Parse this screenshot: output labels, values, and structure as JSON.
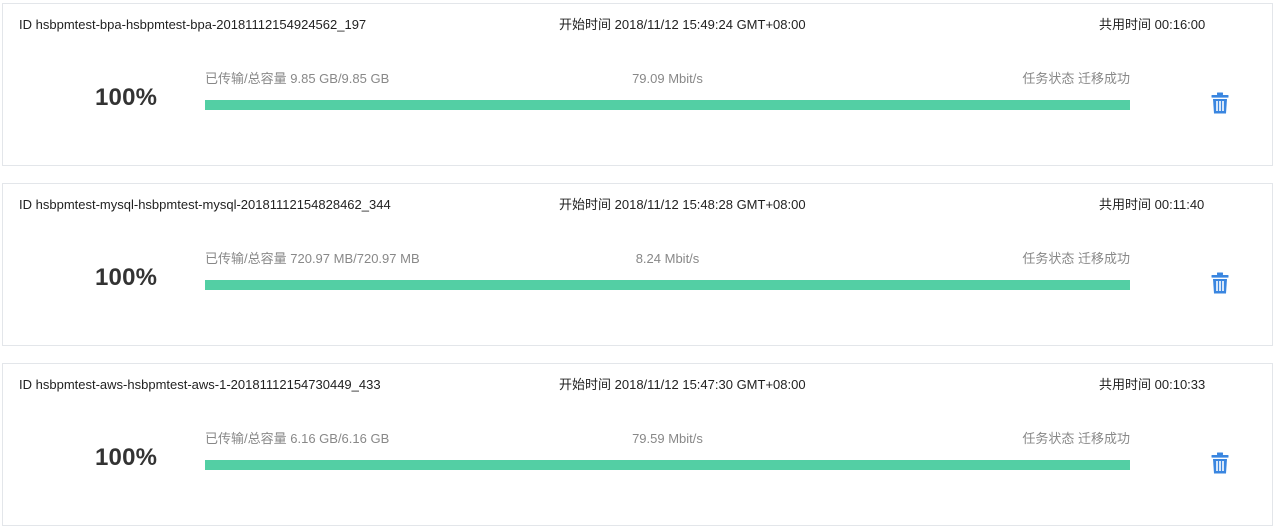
{
  "colors": {
    "progress_fill": "#53cfa4",
    "progress_track": "#e9edf1",
    "delete_icon": "#3a86e0"
  },
  "tasks": [
    {
      "id_label": "ID",
      "id": "hsbpmtest-bpa-hsbpmtest-bpa-20181112154924562_197",
      "start_label": "开始时间",
      "start_time": "2018/11/12 15:49:24 GMT+08:00",
      "elapsed_label": "共用时间",
      "elapsed": "00:16:00",
      "percent": "100%",
      "progress": 1.0,
      "transferred_label": "已传输/总容量",
      "transferred": "9.85 GB/9.85 GB",
      "speed": "79.09 Mbit/s",
      "status_label": "任务状态",
      "status": "迁移成功",
      "icon": "trash-icon"
    },
    {
      "id_label": "ID",
      "id": "hsbpmtest-mysql-hsbpmtest-mysql-20181112154828462_344",
      "start_label": "开始时间",
      "start_time": "2018/11/12 15:48:28 GMT+08:00",
      "elapsed_label": "共用时间",
      "elapsed": "00:11:40",
      "percent": "100%",
      "progress": 1.0,
      "transferred_label": "已传输/总容量",
      "transferred": "720.97 MB/720.97 MB",
      "speed": "8.24 Mbit/s",
      "status_label": "任务状态",
      "status": "迁移成功",
      "icon": "trash-icon"
    },
    {
      "id_label": "ID",
      "id": "hsbpmtest-aws-hsbpmtest-aws-1-20181112154730449_433",
      "start_label": "开始时间",
      "start_time": "2018/11/12 15:47:30 GMT+08:00",
      "elapsed_label": "共用时间",
      "elapsed": "00:10:33",
      "percent": "100%",
      "progress": 1.0,
      "transferred_label": "已传输/总容量",
      "transferred": "6.16 GB/6.16 GB",
      "speed": "79.59 Mbit/s",
      "status_label": "任务状态",
      "status": "迁移成功",
      "icon": "trash-icon"
    }
  ]
}
